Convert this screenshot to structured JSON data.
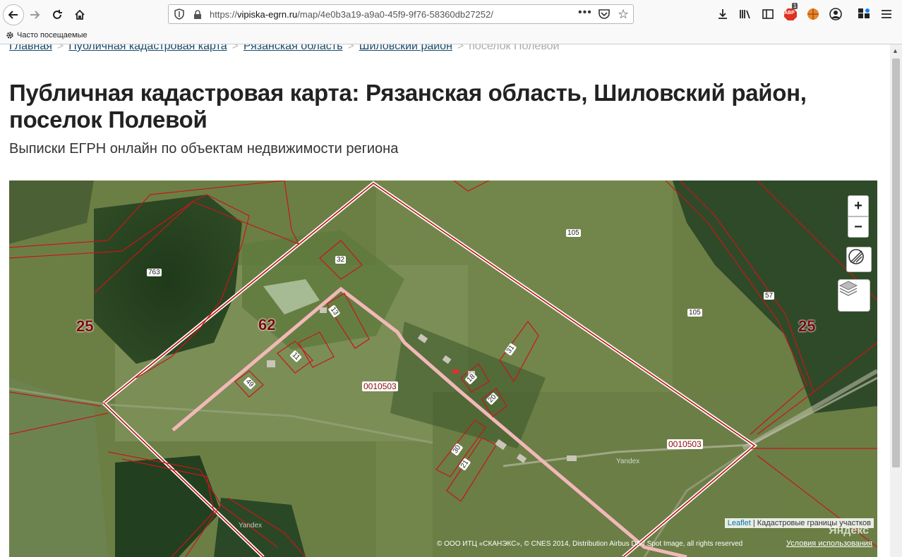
{
  "browser": {
    "url_prefix": "https://",
    "url_host": "vipiska-egrn.ru",
    "url_path": "/map/4e0b3a19-a9a0-45f9-9f76-58360db27252/",
    "more_label": "•••",
    "bookmarks_label": "Часто посещаемые",
    "abp_badge": "1",
    "abp_label": "ABP"
  },
  "breadcrumb": {
    "items": [
      "Главная",
      "Публичная кадастровая карта",
      "Рязанская область",
      "Шиловский район"
    ],
    "current": "поселок Полевой",
    "separator": ">"
  },
  "page": {
    "title": "Публичная кадастровая карта: Рязанская область, Шиловский район, поселок Полевой",
    "subtitle": "Выписки ЕГРН онлайн по объектам недвижимости региона"
  },
  "map": {
    "zoom_in_label": "+",
    "zoom_out_label": "−",
    "labels": {
      "l763": "763",
      "l105a": "105",
      "l105b": "105",
      "l57": "57",
      "l32": "32",
      "l13": "13",
      "l11": "11",
      "l49": "49",
      "l18": "18",
      "l20": "20",
      "l31": "31",
      "l30": "30",
      "l21": "21",
      "quarter1": "0010503",
      "quarter2": "0010503"
    },
    "big_labels": {
      "d25a": "25",
      "d62": "62",
      "d25b": "25"
    },
    "watermark": "Yandex",
    "attribution_link": "Leaflet",
    "attribution_text": "| Кадастровые границы участков",
    "copyright": "© ООО ИТЦ «СКАНЭКС», © CNES 2014, Distribution Airbus DS / Spot Image, all rights reserved",
    "terms": "Условия использования",
    "yandex_logo": "Яндекс"
  }
}
